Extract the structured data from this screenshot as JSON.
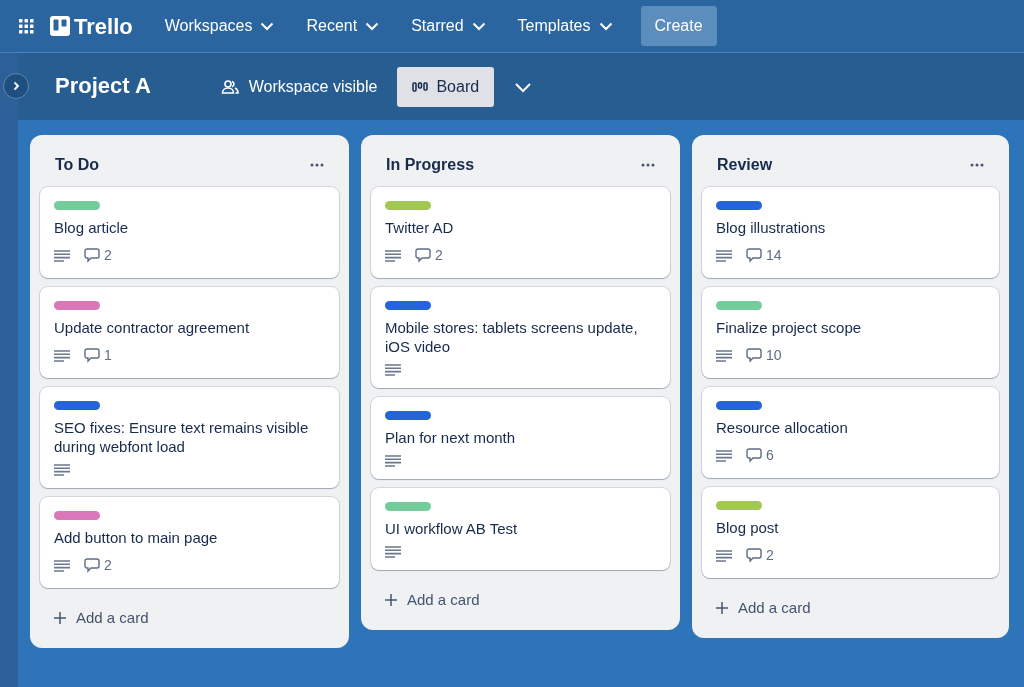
{
  "topnav": {
    "logo": "Trello",
    "menus": [
      {
        "label": "Workspaces"
      },
      {
        "label": "Recent"
      },
      {
        "label": "Starred"
      },
      {
        "label": "Templates"
      }
    ],
    "create": "Create"
  },
  "board": {
    "title": "Project A",
    "visibility": "Workspace visible",
    "view": "Board"
  },
  "lists": [
    {
      "title": "To Do",
      "add": "Add a card",
      "cards": [
        {
          "title": "Blog article",
          "color": "#75cc9b",
          "description": true,
          "comments": "2"
        },
        {
          "title": "Update contractor agreement",
          "color": "#d977b8",
          "description": true,
          "comments": "1"
        },
        {
          "title": "SEO fixes: Ensure text remains visible during webfont load",
          "color": "#2864d9",
          "description": true
        },
        {
          "title": "Add button to main page",
          "color": "#d977b8",
          "description": true,
          "comments": "2"
        }
      ]
    },
    {
      "title": "In Progress",
      "add": "Add a card",
      "cards": [
        {
          "title": "Twitter AD",
          "color": "#a2c752",
          "description": true,
          "comments": "2"
        },
        {
          "title": "Mobile stores: tablets screens update, iOS video",
          "color": "#2864d9",
          "description": true
        },
        {
          "title": "Plan for next month",
          "color": "#2864d9",
          "description": true
        },
        {
          "title": "UI workflow AB Test",
          "color": "#75cc9b",
          "description": true
        }
      ]
    },
    {
      "title": "Review",
      "add": "Add a card",
      "cards": [
        {
          "title": "Blog illustrations",
          "color": "#2864d9",
          "description": true,
          "comments": "14"
        },
        {
          "title": "Finalize project scope",
          "color": "#75cc9b",
          "description": true,
          "comments": "10"
        },
        {
          "title": "Resource allocation",
          "color": "#2864d9",
          "description": true,
          "comments": "6"
        },
        {
          "title": "Blog post",
          "color": "#a2c752",
          "description": true,
          "comments": "2"
        }
      ]
    }
  ]
}
